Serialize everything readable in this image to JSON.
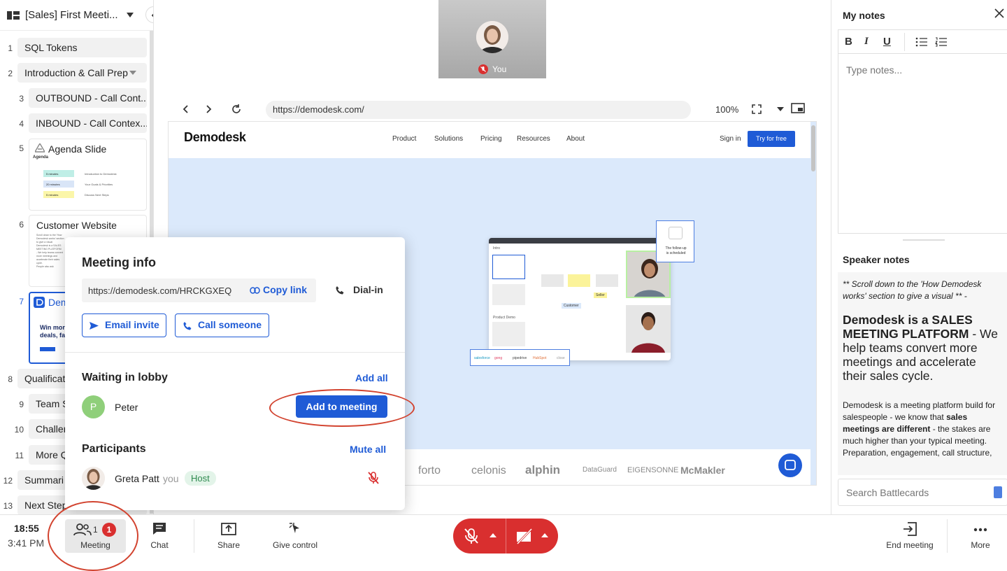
{
  "sidebar": {
    "title": "[Sales] First Meeti...",
    "items": [
      {
        "num": "1",
        "label": "SQL Tokens"
      },
      {
        "num": "2",
        "label": "Introduction & Call Prep"
      },
      {
        "num": "3",
        "label": "OUTBOUND - Call Cont..."
      },
      {
        "num": "4",
        "label": "INBOUND - Call Contex..."
      },
      {
        "num": "5",
        "label": "Agenda Slide"
      },
      {
        "num": "6",
        "label": "Customer Website"
      },
      {
        "num": "7",
        "label": "Dem"
      },
      {
        "num": "8",
        "label": "Qualificat"
      },
      {
        "num": "9",
        "label": "Team S"
      },
      {
        "num": "10",
        "label": "Challer"
      },
      {
        "num": "11",
        "label": "More Q"
      },
      {
        "num": "12",
        "label": "Summari"
      },
      {
        "num": "13",
        "label": "Next Step"
      }
    ],
    "agenda_thumb": {
      "heading": "Agenda",
      "rows": [
        {
          "time": "5 minutes",
          "text": "Introduction to Demodesk",
          "color": "#bfeee6"
        },
        {
          "time": "20 minutes",
          "text": "Your Goals & Priorities",
          "color": "#d9e5f7"
        },
        {
          "time": "5 minutes",
          "text": "Discuss Next Steps",
          "color": "#fbf6a9"
        }
      ]
    },
    "website_thumb": {
      "lines": [
        "Scroll down to the 'How",
        "Demodesk works' section",
        "to give a visual",
        "Demodesk is a SALES",
        "MEETING PLATFORM",
        "- We help teams convert",
        "more meetings and",
        "accelerate their sales",
        "cycle.",
        "People also ask"
      ]
    },
    "demo_thumb": {
      "line1": "Win more",
      "line2": "deals, fas"
    }
  },
  "stage": {
    "self_label": "You",
    "url": "https://demodesk.com/",
    "zoom": "100%",
    "website": {
      "logo": "Demodesk",
      "nav": [
        "Product",
        "Solutions",
        "Pricing",
        "Resources",
        "About"
      ],
      "signin": "Sign in",
      "cta": "Try for free",
      "graphic": {
        "intro": "Intro",
        "product_demo": "Product Demo",
        "followup_line1": "The follow-up",
        "followup_line2": "is scheduled",
        "customer_tag": "Customer",
        "seller_tag": "Seller",
        "crm_logos": [
          "salesforce",
          "gong",
          "pipedrive",
          "HubSpot",
          "close"
        ]
      },
      "logos": [
        "forto",
        "celonis",
        "alphin",
        "DataGuard",
        "EIGENSONNE",
        "McMakler"
      ]
    }
  },
  "notes": {
    "title": "My notes",
    "placeholder": "Type notes...",
    "speaker_title": "Speaker notes",
    "speaker_intro": "** Scroll down to the 'How Demodesk works' section to give a visual ** -",
    "speaker_big_bold": "Demodesk is a SALES MEETING PLATFORM",
    "speaker_big_rest": " - We help teams convert more meetings and accelerate their sales cycle.",
    "speaker_p_start": "Demodesk is a meeting platform build for salespeople - we know that ",
    "speaker_p_bold": "sales meetings are different",
    "speaker_p_end": " - the stakes are much higher than your typical meeting. Preparation, engagement, call structure,",
    "search_placeholder": "Search Battlecards"
  },
  "popup": {
    "title": "Meeting info",
    "link": "https://demodesk.com/HRCKGXEQ",
    "copy_link": "Copy link",
    "dial_in": "Dial-in",
    "email_invite": "Email invite",
    "call_someone": "Call someone",
    "lobby_title": "Waiting in lobby",
    "add_all": "Add all",
    "lobby_person": {
      "initial": "P",
      "name": "Peter"
    },
    "add_to_meeting": "Add to meeting",
    "participants_title": "Participants",
    "mute_all": "Mute all",
    "participant": {
      "name": "Greta Patt",
      "you": "you",
      "role": "Host"
    }
  },
  "bottombar": {
    "time": "18:55",
    "clock": "3:41 PM",
    "meeting_label": "Meeting",
    "meeting_count": "1",
    "meeting_badge": "1",
    "chat": "Chat",
    "share": "Share",
    "give_control": "Give control",
    "end_meeting": "End meeting",
    "more": "More"
  },
  "colors": {
    "accent": "#1f5bd6",
    "danger": "#d92f2f",
    "annotation": "#d2432f",
    "host_badge_bg": "#e3f4e9",
    "host_badge_fg": "#2f8a4f",
    "lobby_avatar": "#8fcf7a"
  }
}
